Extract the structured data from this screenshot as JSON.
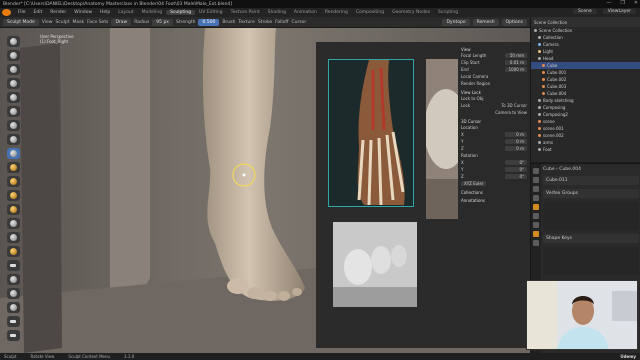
{
  "window": {
    "title": "Blender* [C:\\Users\\DANIEL\\Desktop\\Anatomy Masterclass in Blender\\04 Foot\\03 Male\\Male_Ext.blend]",
    "controls": [
      "—",
      "❐",
      "✕"
    ]
  },
  "menu": {
    "items": [
      "File",
      "Edit",
      "Render",
      "Window",
      "Help"
    ],
    "workspaces": [
      "Layout",
      "Modeling",
      "Sculpting",
      "UV Editing",
      "Texture Paint",
      "Shading",
      "Animation",
      "Rendering",
      "Compositing",
      "Geometry Nodes",
      "Scripting"
    ],
    "active_workspace": "Sculpting",
    "scene": "Scene",
    "view_layer": "ViewLayer"
  },
  "tool_header": {
    "mode": "Sculpt Mode",
    "menus": [
      "View",
      "Sculpt",
      "Mask",
      "Face Sets"
    ],
    "brush": "Draw",
    "radius_label": "Radius",
    "radius_value": "95 px",
    "strength_label": "Strength",
    "strength_value": "0.500",
    "dropdowns": [
      "Brush",
      "Texture",
      "Stroke",
      "Falloff",
      "Cursor"
    ],
    "right": [
      "Dyntopo",
      "Remesh",
      "Options"
    ]
  },
  "viewport": {
    "overlay_lines": [
      "User Perspective",
      "(1) Foot_Right"
    ],
    "colors": {
      "bg": "#6a6460",
      "skin": "#c7b7a5",
      "ref_border": "#2fa7a7"
    }
  },
  "npanel": {
    "view_section": "View",
    "focal_label": "Focal Length",
    "focal_value": "50 mm",
    "clip_start_label": "Clip Start",
    "clip_start_value": "0.01 m",
    "clip_end_label": "End",
    "clip_end_value": "1000 m",
    "local_camera": "Local Camera",
    "render_region": "Render Region",
    "view_lock": "View Lock",
    "lock_to_object": "Lock to Obj",
    "lock": "Lock",
    "to_3d_cursor": "To 3D Cursor",
    "camera_to_view": "Camera to View",
    "cursor_section": "3D Cursor",
    "location": "Location",
    "loc_x": "0 m",
    "loc_y": "0 m",
    "loc_z": "0 m",
    "rotation": "Rotation",
    "rot_x": "0°",
    "rot_y": "0°",
    "rot_z": "0°",
    "xyz_euler": "XYZ Euler",
    "collections": "Collections",
    "annotations": "Annotations"
  },
  "outliner": {
    "header": "Scene Collection",
    "items": [
      {
        "label": "Scene Collection",
        "color": "#aaaaaa",
        "selected": false
      },
      {
        "label": "Collection",
        "color": "#aaaaaa",
        "selected": false
      },
      {
        "label": "Camera",
        "color": "#7fb2e5",
        "selected": false
      },
      {
        "label": "Light",
        "color": "#e5c07f",
        "selected": false
      },
      {
        "label": "Head",
        "color": "#aaaaaa",
        "selected": false
      },
      {
        "label": "Cube",
        "color": "#e58a4f",
        "selected": true
      },
      {
        "label": "Cube.001",
        "color": "#e58a4f",
        "selected": false
      },
      {
        "label": "Cube.002",
        "color": "#e58a4f",
        "selected": false
      },
      {
        "label": "Cube.003",
        "color": "#e58a4f",
        "selected": false
      },
      {
        "label": "Cube.004",
        "color": "#e58a4f",
        "selected": false
      },
      {
        "label": "Body sketching",
        "color": "#aaaaaa",
        "selected": false
      },
      {
        "label": "Composing",
        "color": "#aaaaaa",
        "selected": false
      },
      {
        "label": "Composing2",
        "color": "#aaaaaa",
        "selected": false
      },
      {
        "label": "scene",
        "color": "#e58a4f",
        "selected": false
      },
      {
        "label": "scene.001",
        "color": "#e58a4f",
        "selected": false
      },
      {
        "label": "scene.002",
        "color": "#e58a4f",
        "selected": false
      },
      {
        "label": "arms",
        "color": "#aaaaaa",
        "selected": false
      },
      {
        "label": "Foot",
        "color": "#aaaaaa",
        "selected": false
      }
    ]
  },
  "properties": {
    "object_name": "Cube",
    "data_label": "Cube.004",
    "mesh_name": "Cube.011",
    "vertex_groups": "Vertex Groups",
    "shape_keys": "Shape Keys"
  },
  "statusbar": {
    "items": [
      "Sculpt",
      "Rotate View",
      "Sculpt Context Menu"
    ],
    "version": "3.1.0",
    "brand": "Udemy"
  }
}
